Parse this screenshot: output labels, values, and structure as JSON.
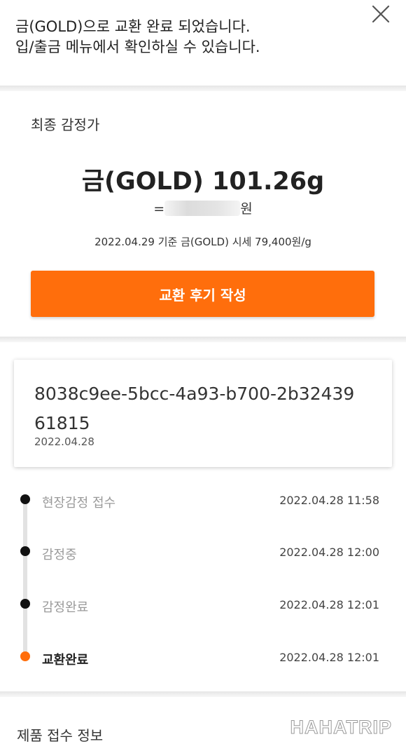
{
  "header": {
    "message_line1": "금(GOLD)으로 교환 완료 되었습니다.",
    "message_line2": "입/출금 메뉴에서 확인하실 수 있습니다."
  },
  "appraisal": {
    "title": "최종 감정가",
    "gold_amount": "금(GOLD) 101.26g",
    "krw_prefix": "=",
    "krw_suffix": "원",
    "price_note": "2022.04.29 기준 금(GOLD) 시세 79,400원/g",
    "review_button_label": "교환 후기 작성"
  },
  "order": {
    "id": "8038c9ee-5bcc-4a93-b700-2b3243961815",
    "date": "2022.04.28"
  },
  "timeline": [
    {
      "label": "현장감정 접수",
      "time": "2022.04.28 11:58",
      "active": false
    },
    {
      "label": "감정중",
      "time": "2022.04.28 12:00",
      "active": false
    },
    {
      "label": "감정완료",
      "time": "2022.04.28 12:01",
      "active": false
    },
    {
      "label": "교환완료",
      "time": "2022.04.28 12:01",
      "active": true
    }
  ],
  "footer": {
    "section_title": "제품 접수 정보",
    "watermark": "HAHATRIP"
  },
  "colors": {
    "accent": "#ff6e0c",
    "dot": "#111111"
  },
  "icons": {
    "close": "close-icon"
  }
}
